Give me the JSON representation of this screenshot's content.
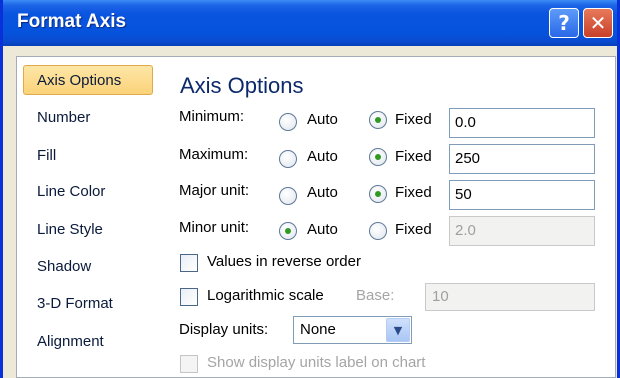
{
  "window": {
    "title": "Format Axis"
  },
  "titlebar": {
    "help_label": "?",
    "close_label": "✕"
  },
  "sidebar": {
    "items": [
      {
        "label": "Axis Options",
        "active": true
      },
      {
        "label": "Number"
      },
      {
        "label": "Fill"
      },
      {
        "label": "Line Color"
      },
      {
        "label": "Line Style"
      },
      {
        "label": "Shadow"
      },
      {
        "label": "3-D Format"
      },
      {
        "label": "Alignment"
      }
    ]
  },
  "panel": {
    "title": "Axis Options",
    "rows": [
      {
        "label": "Minimum:",
        "auto_label": "Auto",
        "fixed_label": "Fixed",
        "selected": "fixed",
        "value": "0.0",
        "enabled": true
      },
      {
        "label": "Maximum:",
        "auto_label": "Auto",
        "fixed_label": "Fixed",
        "selected": "fixed",
        "value": "250",
        "enabled": true
      },
      {
        "label": "Major unit:",
        "auto_label": "Auto",
        "fixed_label": "Fixed",
        "selected": "fixed",
        "value": "50",
        "enabled": true
      },
      {
        "label": "Minor unit:",
        "auto_label": "Auto",
        "fixed_label": "Fixed",
        "selected": "auto",
        "value": "2.0",
        "enabled": false
      }
    ],
    "reverse_order_label": "Values in reverse order",
    "log_scale_label": "Logarithmic scale",
    "base_label": "Base:",
    "base_value": "10",
    "display_units_label": "Display units:",
    "display_units_value": "None",
    "show_units_label": "Show display units label on chart"
  }
}
